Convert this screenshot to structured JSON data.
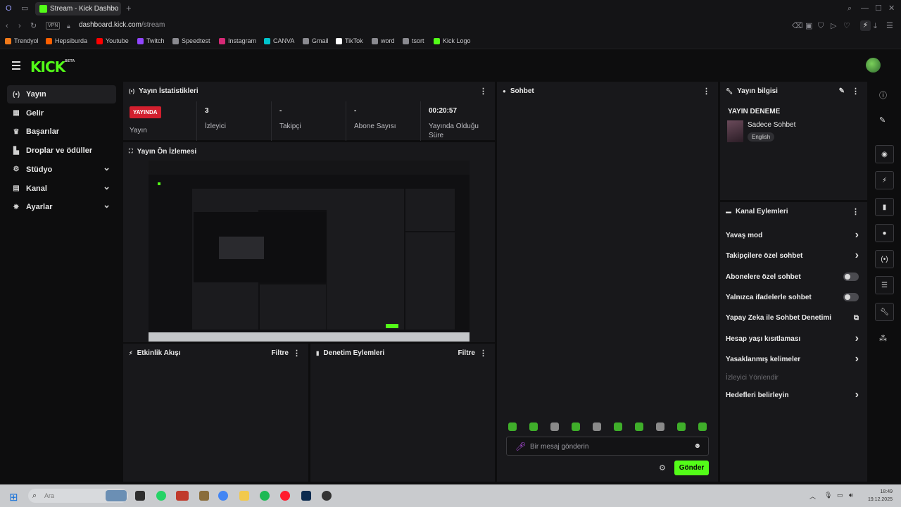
{
  "browser": {
    "tab_title": "Stream - Kick Dashbo",
    "new_tab": "+",
    "vpn_label": "VPN",
    "url_host": "dashboard.kick.com",
    "url_path": "/stream",
    "bookmarks": [
      {
        "label": "Trendyol",
        "color": "#f27a1a"
      },
      {
        "label": "Hepsiburda",
        "color": "#ff6000"
      },
      {
        "label": "Youtube",
        "color": "#ff0000"
      },
      {
        "label": "Twitch",
        "color": "#9146ff"
      },
      {
        "label": "Speedtest",
        "color": "#8a8a90"
      },
      {
        "label": "Instagram",
        "color": "#d62976"
      },
      {
        "label": "CANVA",
        "color": "#00c4cc"
      },
      {
        "label": "Gmail",
        "color": "#8a8a90"
      },
      {
        "label": "TikTok",
        "color": "#ffffff"
      },
      {
        "label": "word",
        "color": "#8a8a90"
      },
      {
        "label": "tsort",
        "color": "#8a8a90"
      },
      {
        "label": "Kick Logo",
        "color": "#53fc18"
      }
    ]
  },
  "app": {
    "logo": "KICK",
    "logo_badge": "BETA",
    "accent": "#53fc18"
  },
  "sidebar": {
    "items": [
      {
        "label": "Yayın",
        "icon": "broadcast-icon",
        "glyph": "(•)",
        "active": true
      },
      {
        "label": "Gelir",
        "icon": "revenue-icon",
        "glyph": "▦"
      },
      {
        "label": "Başarılar",
        "icon": "trophy-icon",
        "glyph": "♛"
      },
      {
        "label": "Droplar ve ödüller",
        "icon": "drops-icon",
        "glyph": "▙"
      },
      {
        "label": "Stüdyo",
        "icon": "studio-icon",
        "glyph": "⚙",
        "expandable": true
      },
      {
        "label": "Kanal",
        "icon": "channel-icon",
        "glyph": "▤",
        "expandable": true
      },
      {
        "label": "Ayarlar",
        "icon": "settings-icon",
        "glyph": "✸",
        "expandable": true
      }
    ]
  },
  "stats_panel": {
    "title": "Yayın İstatistikleri",
    "live_badge": "YAYINDA",
    "live_label": "Yayın",
    "stats": [
      {
        "value": "3",
        "label": "İzleyici"
      },
      {
        "value": "-",
        "label": "Takipçi"
      },
      {
        "value": "-",
        "label": "Abone Sayısı"
      },
      {
        "value": "00:20:57",
        "label": "Yayında Olduğu Süre"
      }
    ]
  },
  "preview_panel": {
    "title": "Yayın Ön İzlemesi"
  },
  "activity_panel": {
    "title": "Etkinlik Akışı",
    "filter": "Filtre"
  },
  "moderation_panel": {
    "title": "Denetim Eylemleri",
    "filter": "Filtre"
  },
  "chat_panel": {
    "title": "Sohbet",
    "input_placeholder": "Bir mesaj gönderin",
    "send_label": "Gönder"
  },
  "stream_info": {
    "title": "Yayın bilgisi",
    "stream_title": "YAYIN DENEME",
    "category": "Sadece Sohbet",
    "language": "English"
  },
  "channel_actions": {
    "title": "Kanal Eylemleri",
    "items": [
      {
        "label": "Yavaş mod",
        "control": "arrow"
      },
      {
        "label": "Takipçilere özel sohbet",
        "control": "arrow"
      },
      {
        "label": "Abonelere özel sohbet",
        "control": "toggle"
      },
      {
        "label": "Yalnızca ifadelerle sohbet",
        "control": "toggle"
      },
      {
        "label": "Yapay Zeka ile Sohbet Denetimi",
        "control": "external"
      },
      {
        "label": "Hesap yaşı kısıtlaması",
        "control": "arrow"
      },
      {
        "label": "Yasaklanmış kelimeler",
        "control": "arrow"
      },
      {
        "label": "İzleyici Yönlendir",
        "control": "none",
        "disabled": true
      },
      {
        "label": "Hedefleri belirleyin",
        "control": "arrow"
      }
    ]
  },
  "taskbar": {
    "search_placeholder": "Ara",
    "time": "18:49",
    "date": "19.12.2025"
  }
}
